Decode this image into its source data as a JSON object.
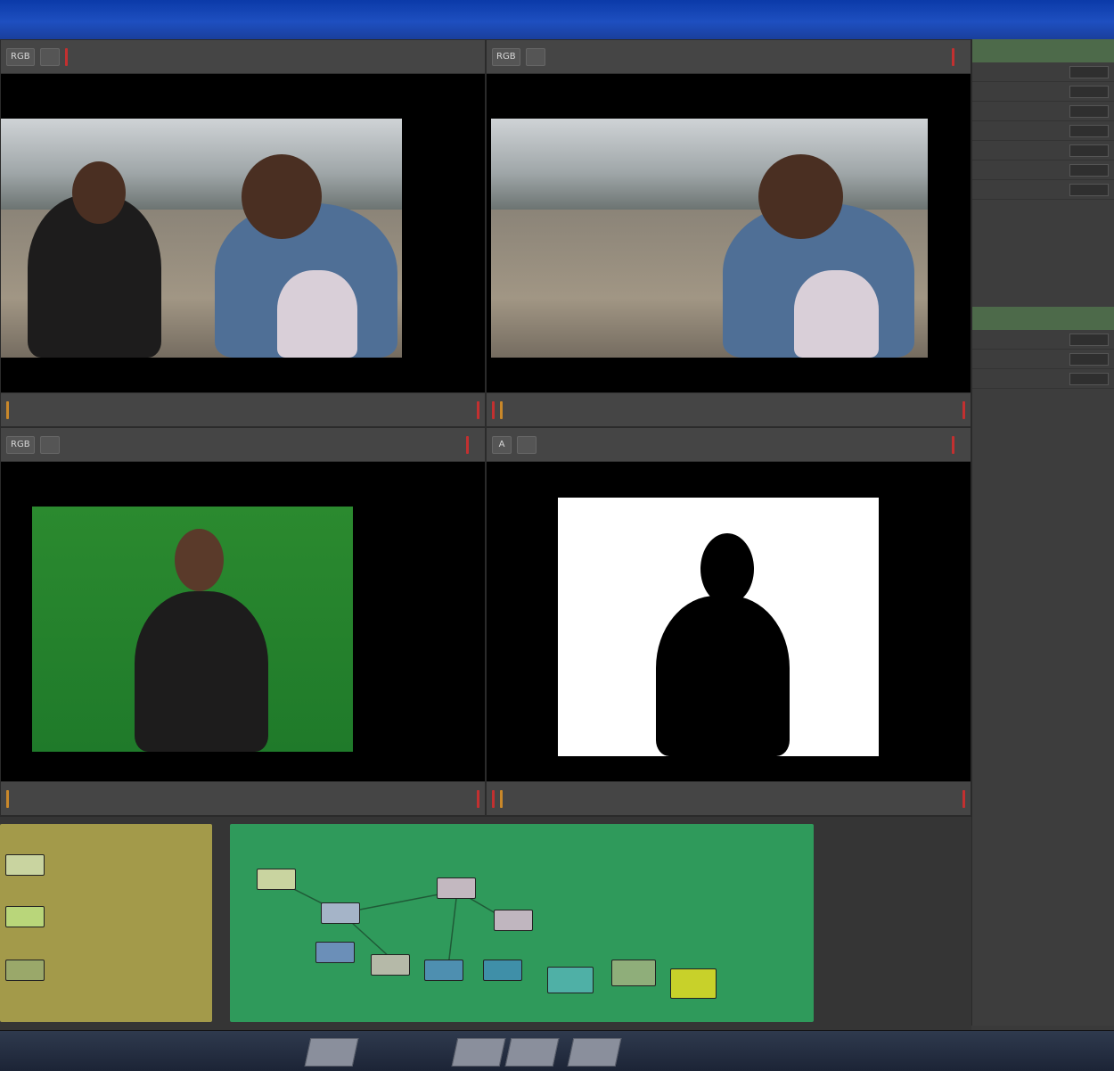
{
  "window": {
    "title": ""
  },
  "viewers": [
    {
      "id": "v1",
      "toolbar_top": {
        "zoom": "",
        "channel": "RGB",
        "frame": ""
      },
      "toolbar_bottom": {
        "frame": ""
      }
    },
    {
      "id": "v2",
      "toolbar_top": {
        "zoom": "",
        "channel": "RGB",
        "frame": ""
      },
      "toolbar_bottom": {
        "frame": ""
      }
    },
    {
      "id": "v3",
      "toolbar_top": {
        "zoom": "",
        "channel": "RGB",
        "frame": ""
      },
      "toolbar_bottom": {
        "frame": ""
      }
    },
    {
      "id": "v4",
      "toolbar_top": {
        "zoom": "",
        "channel": "A",
        "frame": ""
      },
      "toolbar_bottom": {
        "frame": ""
      }
    }
  ],
  "side_panel": {
    "header": "",
    "rows": [
      {
        "label": "",
        "value": ""
      },
      {
        "label": "",
        "value": ""
      },
      {
        "label": "",
        "value": ""
      },
      {
        "label": "",
        "value": ""
      },
      {
        "label": "",
        "value": ""
      },
      {
        "label": "",
        "value": ""
      },
      {
        "label": "",
        "value": ""
      },
      {
        "label": "",
        "value": ""
      },
      {
        "label": "",
        "value": ""
      },
      {
        "label": "",
        "value": ""
      }
    ],
    "header2": ""
  },
  "node_graph": {
    "backdrops": [
      {
        "label": "",
        "color": "#a39a4a"
      },
      {
        "label": "",
        "color": "#2f9a5b"
      }
    ],
    "nodes": [
      {
        "label": "",
        "color": "#c9d4a0"
      },
      {
        "label": "",
        "color": "#b9d67a"
      },
      {
        "label": "",
        "color": "#9aa86a"
      },
      {
        "label": "",
        "color": "#a5b4c8"
      },
      {
        "label": "",
        "color": "#6b8fb8"
      },
      {
        "label": "",
        "color": "#c3b8c0"
      },
      {
        "label": "",
        "color": "#c0b6bf"
      },
      {
        "label": "",
        "color": "#b5b9a8"
      },
      {
        "label": "",
        "color": "#4e8fb0"
      },
      {
        "label": "",
        "color": "#3f8fa8"
      },
      {
        "label": "",
        "color": "#4fb0a6"
      },
      {
        "label": "",
        "color": "#8fae7a"
      },
      {
        "label": "",
        "color": "#c8d12a"
      }
    ]
  },
  "status_bar": {
    "tabs": [
      "",
      "",
      "",
      ""
    ]
  },
  "colors": {
    "titlebar": "#1e4fc0",
    "panel_bg": "#3a3a3a",
    "green_screen": "#2b8a2f",
    "matte_white": "#ffffff"
  }
}
